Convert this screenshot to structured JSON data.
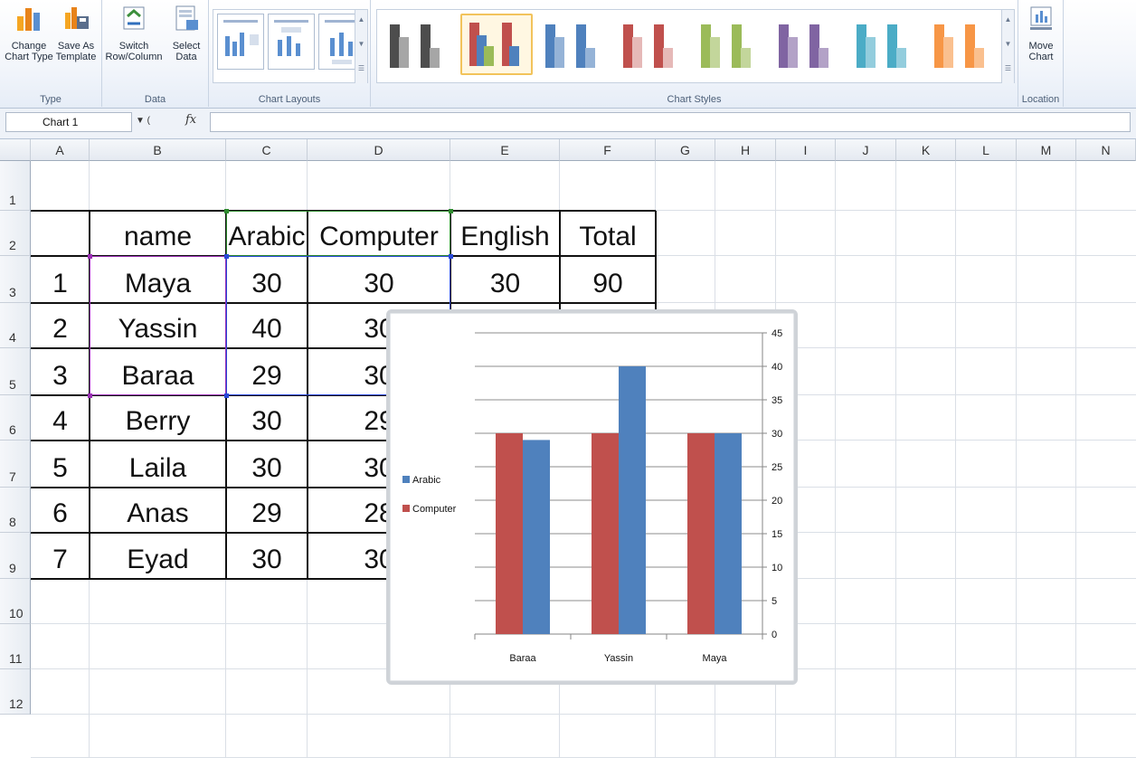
{
  "ribbon": {
    "type_group": {
      "label": "Type",
      "change_chart_type": [
        "Change",
        "Chart Type"
      ],
      "save_as_template": [
        "Save As",
        "Template"
      ]
    },
    "data_group": {
      "label": "Data",
      "switch_row_column": [
        "Switch",
        "Row/Column"
      ],
      "select_data": [
        "Select",
        "Data"
      ]
    },
    "layouts_group": {
      "label": "Chart Layouts"
    },
    "styles_group": {
      "label": "Chart Styles",
      "styles": [
        {
          "c1": "#4d4d4d",
          "c2": "#a6a6a6"
        },
        {
          "c1": "#c0504d",
          "c2": "#4f81bd",
          "c3": "#9bbb59"
        },
        {
          "c1": "#4f81bd",
          "c2": "#95b3d7"
        },
        {
          "c1": "#c0504d",
          "c2": "#e6b9b8"
        },
        {
          "c1": "#9bbb59",
          "c2": "#c3d69b"
        },
        {
          "c1": "#8064a2",
          "c2": "#b3a2c7"
        },
        {
          "c1": "#4bacc6",
          "c2": "#93cddd"
        },
        {
          "c1": "#f79646",
          "c2": "#fac08f"
        }
      ],
      "selected_index": 1
    },
    "location_group": {
      "label": "Location",
      "move_chart": [
        "Move",
        "Chart"
      ]
    }
  },
  "formula_bar": {
    "name_box": "Chart 1",
    "fx": "fx",
    "formula": ""
  },
  "columns": [
    "A",
    "B",
    "C",
    "D",
    "E",
    "F",
    "G",
    "H",
    "I",
    "J",
    "K",
    "L",
    "M",
    "N"
  ],
  "rows": [
    "1",
    "2",
    "3",
    "4",
    "5",
    "6",
    "7",
    "8",
    "9",
    "10",
    "11",
    "12"
  ],
  "table": {
    "headers": [
      "name",
      "Arabic",
      "Computer",
      "English",
      "Total"
    ],
    "rows": [
      {
        "num": "1",
        "name": "Maya",
        "arabic": "30",
        "computer": "30",
        "english": "30",
        "total": "90"
      },
      {
        "num": "2",
        "name": "Yassin",
        "arabic": "40",
        "computer": "30",
        "english": "",
        "total": ""
      },
      {
        "num": "3",
        "name": "Baraa",
        "arabic": "29",
        "computer": "30",
        "english": "",
        "total": ""
      },
      {
        "num": "4",
        "name": "Berry",
        "arabic": "30",
        "computer": "29",
        "english": "",
        "total": ""
      },
      {
        "num": "5",
        "name": "Laila",
        "arabic": "30",
        "computer": "30",
        "english": "",
        "total": ""
      },
      {
        "num": "6",
        "name": "Anas",
        "arabic": "29",
        "computer": "28",
        "english": "",
        "total": ""
      },
      {
        "num": "7",
        "name": "Eyad",
        "arabic": "30",
        "computer": "30",
        "english": "",
        "total": ""
      }
    ]
  },
  "chart_data": {
    "type": "bar",
    "categories": [
      "Baraa",
      "Yassin",
      "Maya"
    ],
    "series": [
      {
        "name": "Arabic",
        "values": [
          29,
          40,
          30
        ],
        "color": "#4f81bd"
      },
      {
        "name": "Computer",
        "values": [
          30,
          30,
          30
        ],
        "color": "#c0504d"
      }
    ],
    "ylim": [
      0,
      45
    ],
    "yticks": [
      0,
      5,
      10,
      15,
      20,
      25,
      30,
      35,
      40,
      45
    ],
    "y_axis_side": "right",
    "legend_position": "left",
    "grid": true
  }
}
